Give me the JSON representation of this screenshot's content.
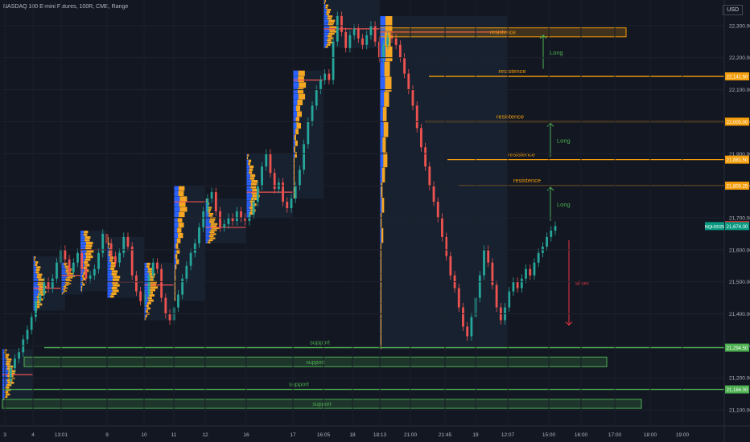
{
  "header": {
    "title": "NASDAQ 100 E-mini Futures, 100R, CME, Range",
    "currency": "USD"
  },
  "chart_data": {
    "type": "candlestick",
    "symbol": "NQH2025",
    "ylim": [
      21050,
      22380
    ],
    "y_ticks": [
      "21,100.00",
      "21,200.00",
      "21,300.00",
      "21,400.00",
      "21,500.00",
      "21,600.00",
      "21,700.00",
      "21,800.00",
      "21,900.00",
      "22,000.00",
      "22,100.00",
      "22,200.00",
      "22,300.00"
    ],
    "x_ticks": [
      "3",
      "4",
      "13:01",
      "9",
      "10",
      "11",
      "12",
      "16",
      "17",
      "16:05",
      "18",
      "18:13",
      "21:00",
      "21:45",
      "19",
      "12:07",
      "15:00",
      "16:00",
      "17:00",
      "18:00",
      "19:00"
    ],
    "price_labels": [
      {
        "value": 22141.5,
        "text": "22,141.50",
        "color": "#f59e0b"
      },
      {
        "value": 22000,
        "text": "22,000.00",
        "color": "#f59e0b"
      },
      {
        "value": 21881.5,
        "text": "21,881.50",
        "color": "#f59e0b"
      },
      {
        "value": 21800.25,
        "text": "21,800.25",
        "color": "#f59e0b"
      },
      {
        "value": 21677.25,
        "text": "21,677.25",
        "color": "#d32f2f"
      },
      {
        "value": 21674,
        "text": "21,674.00",
        "color": "#089981"
      },
      {
        "value": 21294.5,
        "text": "21,294.50",
        "color": "#4caf50"
      },
      {
        "value": 21164,
        "text": "21,164.00",
        "color": "#4caf50"
      }
    ],
    "current_symbol_label": {
      "value": 21674,
      "text": "NQH2025"
    },
    "horizontal_lines": [
      {
        "label": "resistence",
        "value": 22141.5,
        "color": "#f59e0b"
      },
      {
        "label": "resistence",
        "value": 22000,
        "color": "#f59e0b"
      },
      {
        "label": "resistence",
        "value": 21881.5,
        "color": "#f59e0b"
      },
      {
        "label": "resistence",
        "value": 21800.25,
        "color": "#f59e0b"
      },
      {
        "label": "support",
        "value": 21294.5,
        "color": "#4caf50"
      },
      {
        "label": "support",
        "value": 21164,
        "color": "#4caf50"
      }
    ],
    "zones": [
      {
        "label": "resistence",
        "y_top": 22293,
        "y_bottom": 22265,
        "color": "#f59e0b"
      },
      {
        "label": "support",
        "y_top": 21265,
        "y_bottom": 21235,
        "color": "#4caf50"
      },
      {
        "label": "support",
        "y_top": 21133,
        "y_bottom": 21105,
        "color": "#4caf50"
      }
    ],
    "arrows": [
      {
        "label": "Long",
        "direction": "up",
        "from": 22165,
        "to": 22270,
        "color": "#4caf50"
      },
      {
        "label": "Long",
        "direction": "up",
        "from": 21890,
        "to": 21995,
        "color": "#4caf50"
      },
      {
        "label": "Long",
        "direction": "up",
        "from": 21690,
        "to": 21795,
        "color": "#4caf50"
      },
      {
        "label": "short",
        "direction": "down",
        "from": 21630,
        "to": 21365,
        "color": "#f23645"
      }
    ],
    "price_path": [
      21190,
      21230,
      21260,
      21280,
      21320,
      21350,
      21390,
      21440,
      21460,
      21500,
      21480,
      21510,
      21560,
      21600,
      21570,
      21530,
      21560,
      21590,
      21540,
      21510,
      21520,
      21540,
      21590,
      21650,
      21620,
      21580,
      21560,
      21590,
      21640,
      21610,
      21520,
      21470,
      21440,
      21460,
      21520,
      21560,
      21540,
      21450,
      21400,
      21380,
      21420,
      21460,
      21510,
      21550,
      21590,
      21620,
      21670,
      21720,
      21760,
      21780,
      21720,
      21670,
      21680,
      21700,
      21690,
      21720,
      21700,
      21690,
      21710,
      21750,
      21800,
      21860,
      21900,
      21840,
      21790,
      21810,
      21750,
      21730,
      21760,
      21800,
      21850,
      21930,
      22000,
      22050,
      22100,
      22130,
      22150,
      22130,
      22250,
      22330,
      22280,
      22230,
      22270,
      22290,
      22260,
      22240,
      22270,
      22300,
      22250,
      22200,
      22240,
      22270,
      22260,
      22240,
      22200,
      22150,
      22100,
      22050,
      21980,
      21920,
      21860,
      21800,
      21750,
      21700,
      21640,
      21580,
      21520,
      21480,
      21420,
      21360,
      21330,
      21390,
      21450,
      21520,
      21600,
      21560,
      21490,
      21420,
      21380,
      21420,
      21470,
      21500,
      21480,
      21510,
      21540,
      21520,
      21560,
      21590,
      21610,
      21640,
      21660,
      21674
    ]
  }
}
